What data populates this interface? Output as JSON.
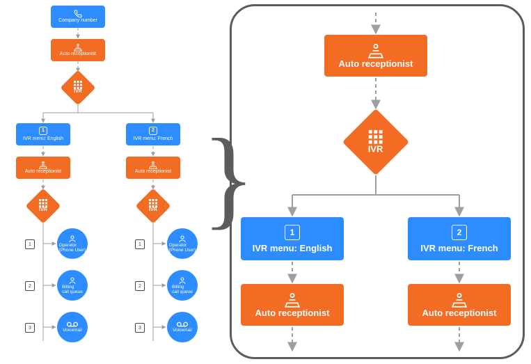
{
  "left": {
    "company_number": "Company number",
    "auto_receptionist": "Auto receptionist",
    "ivr": "IVR",
    "branch_en": {
      "key": "1",
      "menu": "IVR menu: English",
      "auto_receptionist": "Auto receptionist",
      "ivr": "IVR",
      "options": [
        {
          "key": "1",
          "label": "Operator\n(Phone User)"
        },
        {
          "key": "2",
          "label": "Billing\ncall queue"
        },
        {
          "key": "3",
          "label": "Voicemail"
        }
      ]
    },
    "branch_fr": {
      "key": "2",
      "menu": "IVR menu: French",
      "auto_receptionist": "Auto receptionist",
      "ivr": "IVR",
      "options": [
        {
          "key": "1",
          "label": "Operator\n(Phone User)"
        },
        {
          "key": "2",
          "label": "Billing\ncall queue"
        },
        {
          "key": "3",
          "label": "Voicemail"
        }
      ]
    }
  },
  "right": {
    "auto_receptionist": "Auto receptionist",
    "ivr": "IVR",
    "branches": [
      {
        "key": "1",
        "menu": "IVR menu: English",
        "auto_receptionist": "Auto receptionist"
      },
      {
        "key": "2",
        "menu": "IVR menu: French",
        "auto_receptionist": "Auto receptionist"
      }
    ]
  },
  "colors": {
    "blue": "#2d8cff",
    "orange": "#f26c23",
    "wire": "#9e9e9e",
    "panel_border": "#5c5c5c"
  },
  "icons": {
    "phone": "phone-icon",
    "desk": "receptionist-desk-icon",
    "keypad": "keypad-icon",
    "person": "person-icon",
    "voicemail": "voicemail-icon"
  }
}
